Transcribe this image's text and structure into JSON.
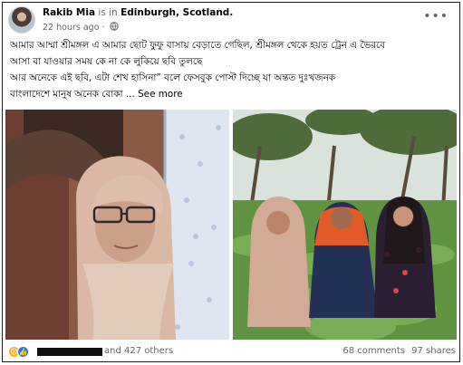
{
  "post": {
    "author": "Rakib Mia",
    "checkin_text": "is in",
    "location": "Edinburgh, Scotland.",
    "time": "22 hours ago",
    "dot": "·",
    "more_icon": "more-icon",
    "text_lines": [
      "আমার আম্মা শ্রীমঙ্গল এ আমার ছোট ফুফু বাসায় বেড়াতে গেছিল, শ্রীমঙ্গল থেকে হয়ত ট্রেন এ ভৈরবে",
      "আসা বা যাওয়ার সময় কে না কে লুকিয়ে ছবি তুলছে",
      "আর অনেকে এই ছবি, এটা শেখ হাসিনা” বলে ফেসবুক পোস্ট দিচ্ছে যা অন্তত দুঃখজনক",
      "বাংলাদেশে মানুষ অনেক বোকা ..."
    ],
    "see_more": "See more"
  },
  "engagement": {
    "reaction_icons": [
      "sad-reaction-icon",
      "like-reaction-icon"
    ],
    "others": "and 427 others",
    "comments": "68 comments",
    "shares": "97 shares"
  },
  "colors": {
    "text": "#050505",
    "secondary": "#65676b",
    "like": "#1877f2",
    "sad": "#f7b125"
  }
}
